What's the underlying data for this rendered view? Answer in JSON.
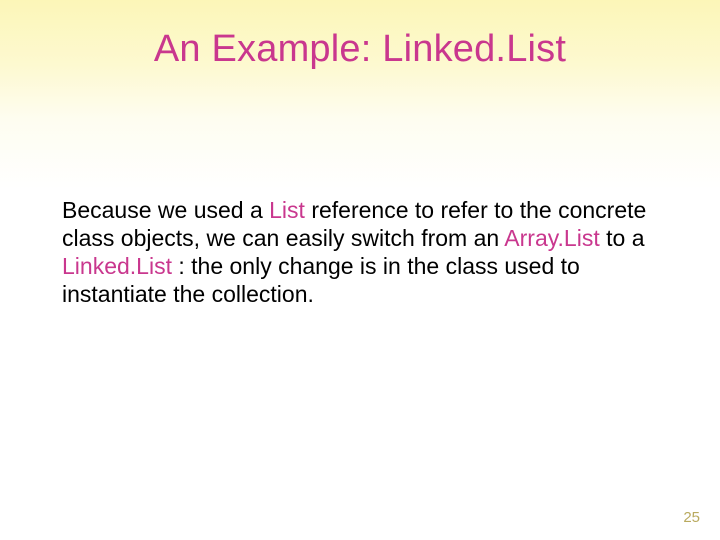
{
  "title": "An Example: Linked.List",
  "body": {
    "t1": "Because we used a ",
    "h1": "List",
    "t2": " reference to refer to the concrete class objects, we can easily switch from an ",
    "h2": "Array.List",
    "t3": " to a ",
    "h3": "Linked.List",
    "t4": " : the only change is in the class used to instantiate the collection."
  },
  "page_number": "25"
}
